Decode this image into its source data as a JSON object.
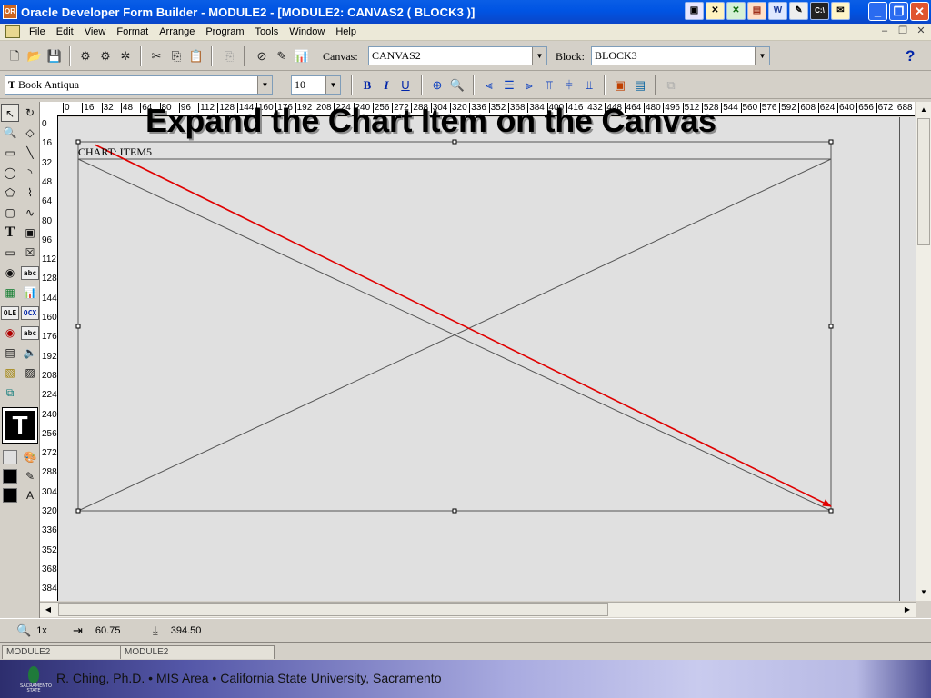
{
  "window": {
    "title": "Oracle Developer Form Builder - MODULE2 - [MODULE2: CANVAS2 ( BLOCK3 )]",
    "controls": [
      "minimize",
      "restore",
      "close"
    ]
  },
  "menu": {
    "items": [
      "File",
      "Edit",
      "View",
      "Format",
      "Arrange",
      "Program",
      "Tools",
      "Window",
      "Help"
    ]
  },
  "toolbar": {
    "canvas_label": "Canvas:",
    "canvas_value": "CANVAS2",
    "block_label": "Block:",
    "block_value": "BLOCK3",
    "help": "?"
  },
  "format_bar": {
    "font": "Book Antiqua",
    "font_prefix": "T",
    "size": "10",
    "bold": "B",
    "italic": "I",
    "underline": "U"
  },
  "palette": {
    "text_tool": "T",
    "ole_label": "OLE",
    "ocx_label": "OCX",
    "abc_label": "abc"
  },
  "rulers": {
    "horizontal": [
      "0",
      "16",
      "32",
      "48",
      "64",
      "80",
      "96",
      "112",
      "128",
      "144",
      "160",
      "176",
      "192",
      "208",
      "224",
      "240",
      "256",
      "272",
      "288",
      "304",
      "320",
      "336",
      "352",
      "368",
      "384",
      "400",
      "416",
      "432",
      "448",
      "464",
      "480",
      "496",
      "512",
      "528",
      "544",
      "560",
      "576",
      "592",
      "608",
      "624",
      "640",
      "656",
      "672",
      "688"
    ],
    "vertical": [
      "0",
      "16",
      "32",
      "48",
      "64",
      "80",
      "96",
      "112",
      "128",
      "144",
      "160",
      "176",
      "192",
      "208",
      "224",
      "240",
      "256",
      "272",
      "288",
      "304",
      "320",
      "336",
      "352",
      "368",
      "384"
    ]
  },
  "canvas": {
    "chart_item_label": "CHART: ITEM5",
    "frame_color": "#555555",
    "arrow_color": "#e00000",
    "background": "#e0e0e0"
  },
  "status": {
    "zoom": "1x",
    "x_position": "60.75",
    "y_position": "394.50"
  },
  "tabs": [
    "MODULE2",
    "MODULE2"
  ],
  "slide": {
    "title": "Expand the Chart Item on the Canvas",
    "footer": "R. Ching, Ph.D. • MIS Area  • California State University, Sacramento",
    "logo_caption": "SACRAMENTO STATE"
  }
}
